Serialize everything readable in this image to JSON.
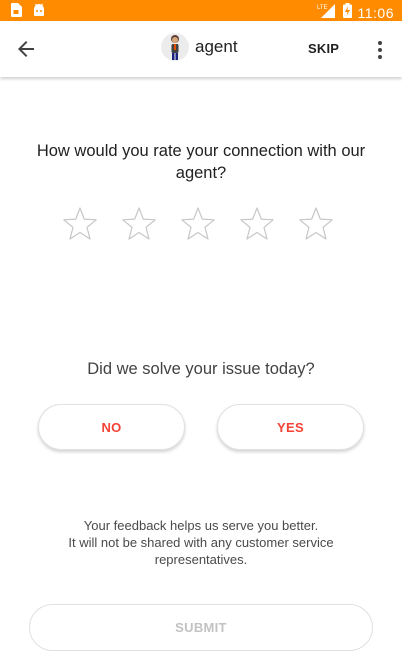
{
  "status_bar": {
    "time": "11:06",
    "network": "LTE",
    "bg_color": "#ff8c00",
    "left_icons": [
      "sim-card-icon",
      "android-icon"
    ],
    "right_icons": [
      "signal-icon",
      "battery-charging-icon"
    ]
  },
  "app_bar": {
    "back_icon": "arrow-left-icon",
    "agent_name": "agent",
    "skip_label": "SKIP",
    "more_icon": "more-vertical-icon"
  },
  "rating": {
    "question": "How would you rate your connection with our agent?",
    "stars_total": 5,
    "stars_selected": 0
  },
  "resolution": {
    "question": "Did we solve your issue today?",
    "no_label": "NO",
    "yes_label": "YES",
    "accent_color": "#f44336"
  },
  "feedback": {
    "line1": "Your feedback helps us serve you better.",
    "line2": "It will not be shared with any customer service",
    "line3": "representatives."
  },
  "submit": {
    "label": "SUBMIT",
    "enabled": false
  }
}
